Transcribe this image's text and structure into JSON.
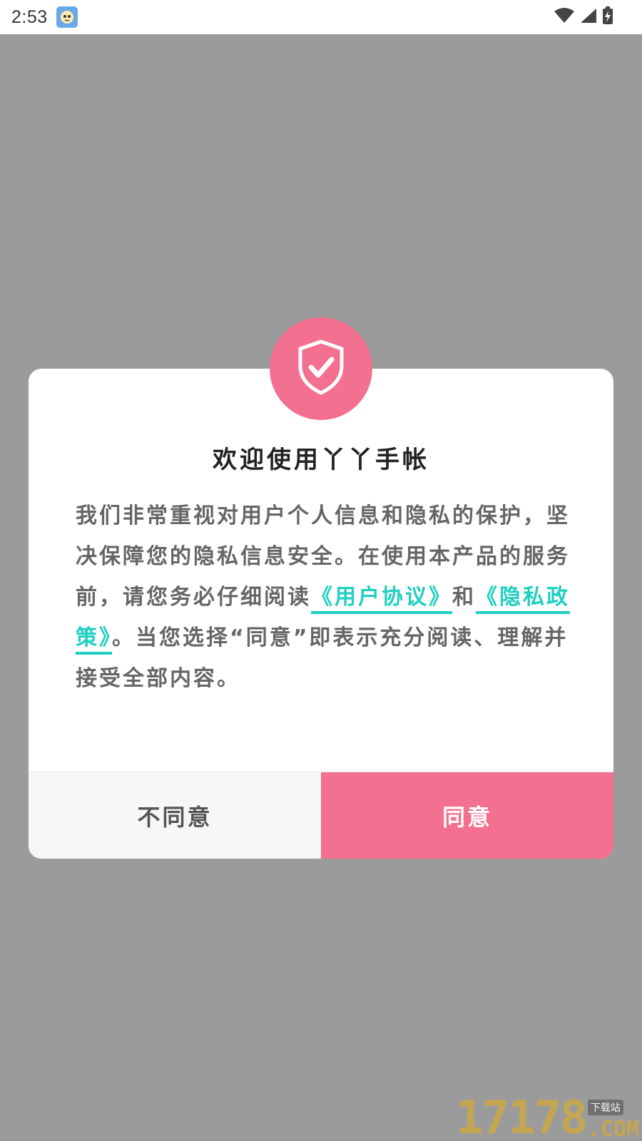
{
  "status_bar": {
    "time": "2:53",
    "app_icon": "app-avatar-icon",
    "icons": [
      "wifi-icon",
      "cell-signal-icon",
      "battery-charging-icon"
    ]
  },
  "dialog": {
    "shield_icon": "shield-check-icon",
    "title": "欢迎使用丫丫手帐",
    "body_part1": "我们非常重视对用户个人信息和隐私的保护，坚决保障您的隐私信息安全。在使用本产品的服务前，请您务必仔细阅读",
    "link_user_agreement": "《用户协议》",
    "body_and": "和",
    "link_privacy_policy": "《隐私政策》",
    "body_part2": "。当您选择“同意”即表示充分阅读、理解并接受全部内容。",
    "disagree_label": "不同意",
    "agree_label": "同意"
  },
  "watermark": {
    "number": "17178",
    "tag": "下载站",
    "domain": ".COM"
  },
  "colors": {
    "overlay": "#9b9b9b",
    "accent_pink": "#f37090",
    "link_teal": "#1fcfc1"
  }
}
